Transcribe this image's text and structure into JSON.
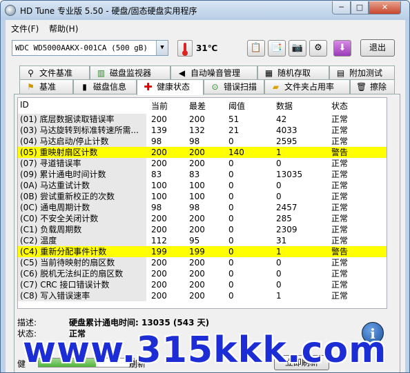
{
  "window": {
    "title": "HD Tune 专业版 5.50 - 硬盘/固态硬盘实用程序",
    "minimize": "─",
    "maximize": "□",
    "close": "✕"
  },
  "menu": {
    "file": "文件(F)",
    "help": "帮助(H)"
  },
  "toolbar": {
    "drive": "WDC WD5000AAKX-001CA  (500 gB)",
    "temperature": "31℃",
    "exit_label": "退出",
    "icons": [
      "copy-icon",
      "copy-all-icon",
      "camera-icon",
      "options-icon",
      "save-icon"
    ]
  },
  "tabs_row1": [
    {
      "label": "文件基准",
      "icon": "file-benchmark-icon"
    },
    {
      "label": "磁盘监视器",
      "icon": "disk-monitor-icon"
    },
    {
      "label": "自动噪音管理",
      "icon": "aam-icon"
    },
    {
      "label": "随机存取",
      "icon": "random-access-icon"
    },
    {
      "label": "附加测试",
      "icon": "extra-tests-icon"
    }
  ],
  "tabs_row2": [
    {
      "label": "基准",
      "icon": "benchmark-icon"
    },
    {
      "label": "磁盘信息",
      "icon": "info-icon"
    },
    {
      "label": "健康状态",
      "icon": "health-icon",
      "active": true
    },
    {
      "label": "错误扫描",
      "icon": "error-scan-icon"
    },
    {
      "label": "文件夹占用率",
      "icon": "folder-usage-icon"
    },
    {
      "label": "擦除",
      "icon": "erase-icon"
    }
  ],
  "table": {
    "columns": [
      "ID",
      "当前",
      "最差",
      "阈值",
      "数据",
      "状态"
    ],
    "rows": [
      {
        "id": "(01) 底层数据读取错误率",
        "current": "200",
        "worst": "200",
        "threshold": "51",
        "data": "42",
        "status": "正常",
        "warn": false
      },
      {
        "id": "(03) 马达旋转到标准转速所需...",
        "current": "139",
        "worst": "132",
        "threshold": "21",
        "data": "4033",
        "status": "正常",
        "warn": false
      },
      {
        "id": "(04) 马达启动/停止计数",
        "current": "98",
        "worst": "98",
        "threshold": "0",
        "data": "2595",
        "status": "正常",
        "warn": false
      },
      {
        "id": "(05) 重映射扇区计数",
        "current": "200",
        "worst": "200",
        "threshold": "140",
        "data": "1",
        "status": "警告",
        "warn": true
      },
      {
        "id": "(07) 寻道错误率",
        "current": "200",
        "worst": "200",
        "threshold": "0",
        "data": "0",
        "status": "正常",
        "warn": false
      },
      {
        "id": "(09) 累计通电时间计数",
        "current": "83",
        "worst": "83",
        "threshold": "0",
        "data": "13035",
        "status": "正常",
        "warn": false
      },
      {
        "id": "(0A) 马达重试计数",
        "current": "100",
        "worst": "100",
        "threshold": "0",
        "data": "0",
        "status": "正常",
        "warn": false
      },
      {
        "id": "(0B) 尝试重新校正的次数",
        "current": "100",
        "worst": "100",
        "threshold": "0",
        "data": "0",
        "status": "正常",
        "warn": false
      },
      {
        "id": "(0C) 通电周期计数",
        "current": "98",
        "worst": "98",
        "threshold": "0",
        "data": "2457",
        "status": "正常",
        "warn": false
      },
      {
        "id": "(C0) 不安全关闭计数",
        "current": "200",
        "worst": "200",
        "threshold": "0",
        "data": "285",
        "status": "正常",
        "warn": false
      },
      {
        "id": "(C1) 负载周期数",
        "current": "200",
        "worst": "200",
        "threshold": "0",
        "data": "2309",
        "status": "正常",
        "warn": false
      },
      {
        "id": "(C2) 温度",
        "current": "112",
        "worst": "95",
        "threshold": "0",
        "data": "31",
        "status": "正常",
        "warn": false
      },
      {
        "id": "(C4) 重新分配事件计数",
        "current": "199",
        "worst": "199",
        "threshold": "0",
        "data": "1",
        "status": "警告",
        "warn": true
      },
      {
        "id": "(C5) 当前待映射的扇区数",
        "current": "200",
        "worst": "200",
        "threshold": "0",
        "data": "0",
        "status": "正常",
        "warn": false
      },
      {
        "id": "(C6) 脱机无法纠正的扇区数",
        "current": "200",
        "worst": "200",
        "threshold": "0",
        "data": "0",
        "status": "正常",
        "warn": false
      },
      {
        "id": "(C7) CRC 接口错误计数",
        "current": "200",
        "worst": "200",
        "threshold": "0",
        "data": "0",
        "status": "正常",
        "warn": false
      },
      {
        "id": "(C8) 写入错误速率",
        "current": "200",
        "worst": "200",
        "threshold": "0",
        "data": "1",
        "status": "正常",
        "warn": false
      }
    ]
  },
  "details": {
    "desc_label": "描述:",
    "desc_text": "硬盘累计通电时间: 13035 (543 天)",
    "status_label": "状态:",
    "status_text": "正常"
  },
  "bottom": {
    "health_label": "健",
    "refresh_label": "刷新",
    "refresh_button": "立即刷新",
    "progress_fraction": 0.6
  },
  "watermark": "www.315kkk.com",
  "colors": {
    "warn_row": "#ffff00",
    "watermark": "#1d2dd6",
    "close_button": "#c8452c"
  }
}
